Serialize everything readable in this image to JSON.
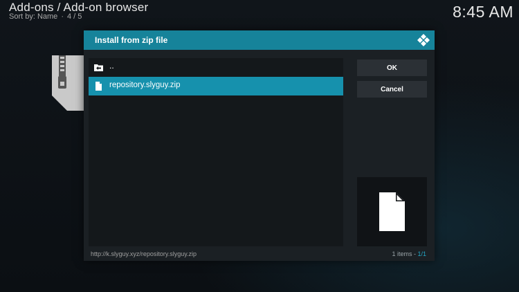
{
  "header": {
    "breadcrumb": "Add-ons / Add-on browser",
    "sort_label": "Sort by: Name",
    "sort_separator": "·",
    "position": "4 / 5",
    "clock": "8:45 AM"
  },
  "dialog": {
    "title": "Install from zip file",
    "parent_item": "..",
    "selected_file": "repository.slyguy.zip",
    "ok_label": "OK",
    "cancel_label": "Cancel",
    "path": "http://k.slyguy.xyz/repository.slyguy.zip",
    "items_count": "1 items - ",
    "page": "1/1"
  },
  "colors": {
    "accent": "#16839a",
    "selection": "#1691ad",
    "dialog_bg": "#1b2024",
    "button_bg": "#2b3035"
  },
  "icons": {
    "logo": "kodi-logo-icon",
    "parent": "folder-up-icon",
    "file": "file-icon",
    "preview": "file-preview-icon",
    "background": "zip-file-icon"
  }
}
